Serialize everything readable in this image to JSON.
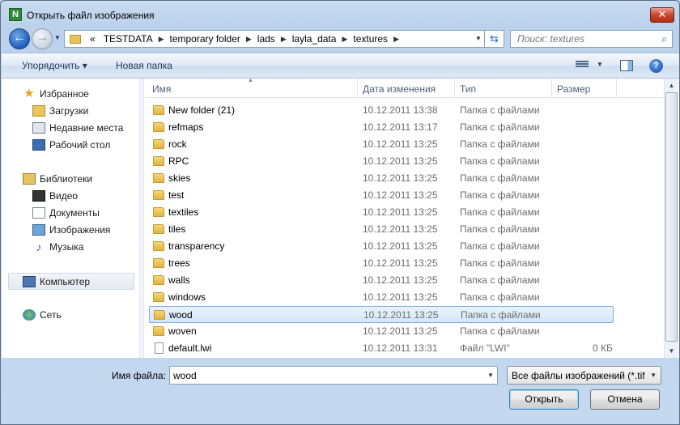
{
  "window": {
    "title": "Открыть файл изображения",
    "close_label": "✕",
    "app_icon_letter": "N"
  },
  "address": {
    "overflow": "«",
    "crumbs": [
      "TESTDATA",
      "temporary folder",
      "lads",
      "layla_data",
      "textures"
    ]
  },
  "search": {
    "placeholder": "Поиск: textures"
  },
  "toolbar": {
    "organize_label": "Упорядочить ▾",
    "new_folder_label": "Новая папка"
  },
  "nav": {
    "favorites": "Избранное",
    "downloads": "Загрузки",
    "recent": "Недавние места",
    "desktop": "Рабочий стол",
    "libraries": "Библиотеки",
    "video": "Видео",
    "documents": "Документы",
    "images": "Изображения",
    "music": "Музыка",
    "computer": "Компьютер",
    "network": "Сеть"
  },
  "columns": {
    "name": "Имя",
    "date": "Дата изменения",
    "type": "Тип",
    "size": "Размер"
  },
  "files": [
    {
      "name": "New folder (21)",
      "date": "10.12.2011 13:38",
      "type": "Папка с файлами",
      "size": "",
      "kind": "folder"
    },
    {
      "name": "refmaps",
      "date": "10.12.2011 13:17",
      "type": "Папка с файлами",
      "size": "",
      "kind": "folder"
    },
    {
      "name": "rock",
      "date": "10.12.2011 13:25",
      "type": "Папка с файлами",
      "size": "",
      "kind": "folder"
    },
    {
      "name": "RPC",
      "date": "10.12.2011 13:25",
      "type": "Папка с файлами",
      "size": "",
      "kind": "folder"
    },
    {
      "name": "skies",
      "date": "10.12.2011 13:25",
      "type": "Папка с файлами",
      "size": "",
      "kind": "folder"
    },
    {
      "name": "test",
      "date": "10.12.2011 13:25",
      "type": "Папка с файлами",
      "size": "",
      "kind": "folder"
    },
    {
      "name": "textiles",
      "date": "10.12.2011 13:25",
      "type": "Папка с файлами",
      "size": "",
      "kind": "folder"
    },
    {
      "name": "tiles",
      "date": "10.12.2011 13:25",
      "type": "Папка с файлами",
      "size": "",
      "kind": "folder"
    },
    {
      "name": "transparency",
      "date": "10.12.2011 13:25",
      "type": "Папка с файлами",
      "size": "",
      "kind": "folder"
    },
    {
      "name": "trees",
      "date": "10.12.2011 13:25",
      "type": "Папка с файлами",
      "size": "",
      "kind": "folder"
    },
    {
      "name": "walls",
      "date": "10.12.2011 13:25",
      "type": "Папка с файлами",
      "size": "",
      "kind": "folder"
    },
    {
      "name": "windows",
      "date": "10.12.2011 13:25",
      "type": "Папка с файлами",
      "size": "",
      "kind": "folder"
    },
    {
      "name": "wood",
      "date": "10.12.2011 13:25",
      "type": "Папка с файлами",
      "size": "",
      "kind": "folder",
      "selected": true
    },
    {
      "name": "woven",
      "date": "10.12.2011 13:25",
      "type": "Папка с файлами",
      "size": "",
      "kind": "folder"
    },
    {
      "name": "default.lwi",
      "date": "10.12.2011 13:31",
      "type": "Файл \"LWI\"",
      "size": "0 КБ",
      "kind": "file"
    }
  ],
  "bottom": {
    "filename_label": "Имя файла:",
    "filename_value": "wood",
    "filter_value": "Все файлы изображений (*.tif",
    "open_label": "Открыть",
    "cancel_label": "Отмена"
  }
}
